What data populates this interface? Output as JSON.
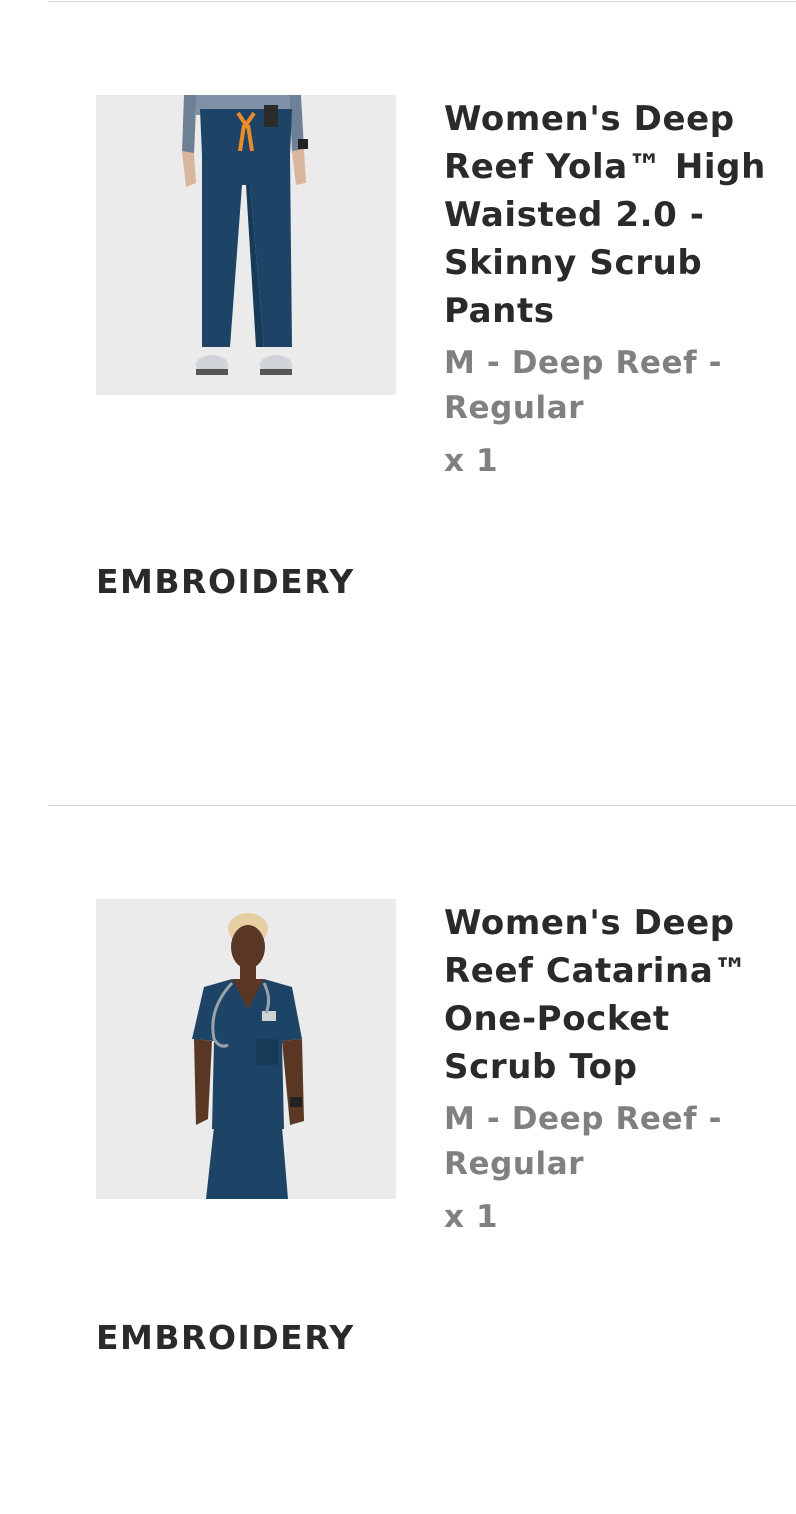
{
  "cart_items": [
    {
      "image_alt": "pants-photo",
      "title": "Women's Deep Reef Yola™ High Waisted 2.0 - Skinny Scrub Pants",
      "variant": "M - Deep Reef - Regular",
      "quantity": "x 1",
      "embroidery_label": "EMBROIDERY"
    },
    {
      "image_alt": "top-photo",
      "title": "Women's Deep Reef Catarina™ One-Pocket Scrub Top",
      "variant": "M - Deep Reef - Regular",
      "quantity": "x 1",
      "embroidery_label": "EMBROIDERY"
    }
  ],
  "colors": {
    "accent": "#1d4466",
    "title_text": "#2a2a2a",
    "variant_text": "#808080",
    "divider": "#d4d4d4"
  }
}
